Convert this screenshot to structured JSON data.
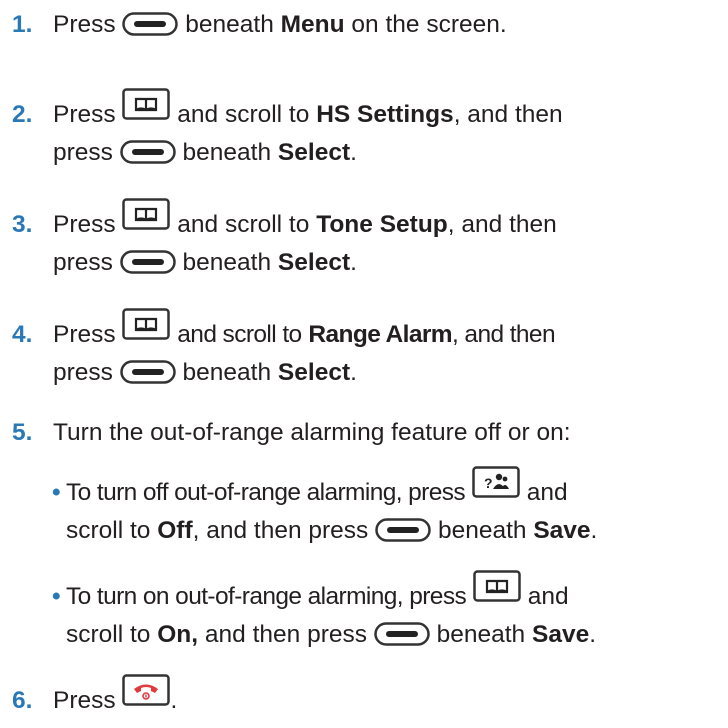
{
  "steps": [
    {
      "num": "1.",
      "a": "Press",
      "b": "beneath",
      "c": "Menu",
      "d": "on the screen."
    },
    {
      "num": "2.",
      "a": "Press",
      "b": "and scroll to",
      "c": "HS Settings",
      "d": ", and then",
      "e": "press",
      "f": "beneath",
      "g": "Select",
      "h": "."
    },
    {
      "num": "3.",
      "a": "Press",
      "b": "and scroll to",
      "c": "Tone Setup",
      "d": ", and then",
      "e": "press",
      "f": "beneath",
      "g": "Select",
      "h": "."
    },
    {
      "num": "4.",
      "a": "Press",
      "b": "and scroll to",
      "c": "Range Alarm",
      "d": ", and then",
      "e": "press",
      "f": "beneath",
      "g": "Select",
      "h": "."
    },
    {
      "num": "5.",
      "a": "Turn the out-of-range alarming feature off or on:"
    },
    {
      "num": "6.",
      "a": "Press",
      "h": "."
    }
  ],
  "bullets": [
    {
      "dot": "•",
      "a": "To turn off out-of-range alarming, press",
      "b": "and",
      "c": "scroll to",
      "d": "Off",
      "e": ", and then press",
      "f": "beneath",
      "g": "Save",
      "h": "."
    },
    {
      "dot": "•",
      "a": "To turn on out-of-range alarming, press",
      "b": "and",
      "c": "scroll to",
      "d": "On,",
      "e": "and then press",
      "f": "beneath",
      "g": "Save",
      "h": "."
    }
  ],
  "icons": {
    "soft_key": "soft-key-icon",
    "phonebook_key": "phonebook-key-icon",
    "intercom_key": "intercom-key-icon",
    "end_call_key": "end-call-key-icon"
  },
  "colors": {
    "step_number": "#2a78b6",
    "text": "#231f20",
    "end_key": "#e03a3e"
  }
}
